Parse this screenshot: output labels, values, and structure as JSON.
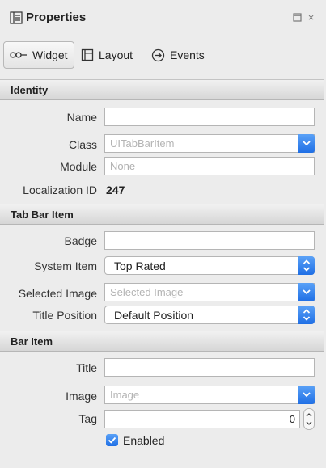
{
  "panel": {
    "title": "Properties",
    "icon": "properties-panel-icon",
    "controls": {
      "maximize": "maximize-icon",
      "close": "×"
    }
  },
  "tabs": [
    {
      "label": "Widget",
      "icon": "widget-icon",
      "active": true
    },
    {
      "label": "Layout",
      "icon": "layout-icon",
      "active": false
    },
    {
      "label": "Events",
      "icon": "events-icon",
      "active": false
    }
  ],
  "identity": {
    "header": "Identity",
    "name_label": "Name",
    "name_value": "",
    "class_label": "Class",
    "class_placeholder": "UITabBarItem",
    "module_label": "Module",
    "module_placeholder": "None",
    "localization_label": "Localization ID",
    "localization_value": "247"
  },
  "tab_bar_item": {
    "header": "Tab Bar Item",
    "badge_label": "Badge",
    "badge_value": "",
    "system_item_label": "System Item",
    "system_item_value": "Top Rated",
    "selected_image_label": "Selected Image",
    "selected_image_placeholder": "Selected Image",
    "title_position_label": "Title Position",
    "title_position_value": "Default Position"
  },
  "bar_item": {
    "header": "Bar Item",
    "title_label": "Title",
    "title_value": "",
    "image_label": "Image",
    "image_placeholder": "Image",
    "tag_label": "Tag",
    "tag_value": "0",
    "enabled_label": "Enabled",
    "enabled_checked": true
  },
  "colors": {
    "accent": "#2f7cf0",
    "panel_bg": "#ececec",
    "section_bg": "#dcdcdc"
  }
}
